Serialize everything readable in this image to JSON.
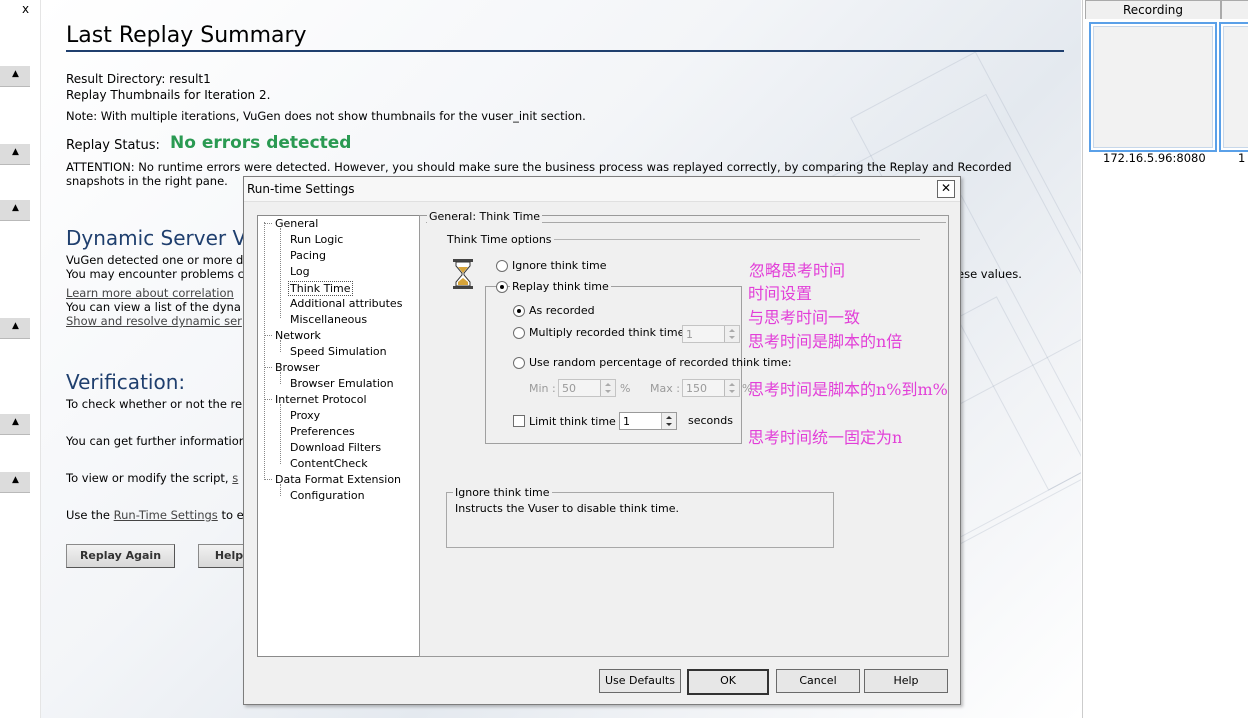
{
  "left_strip": {
    "close_symbol": "x",
    "scroll_symbol": "▲"
  },
  "summary": {
    "title": "Last Replay Summary",
    "result_directory": "Result Directory: result1",
    "thumbnails_line": "Replay Thumbnails for Iteration 2.",
    "note": "Note: With multiple iterations, VuGen does not show thumbnails for the vuser_init section.",
    "replay_status_label": "Replay Status:",
    "replay_status_value": "No errors detected",
    "attention_1": "ATTENTION: No runtime errors were detected. However, you should make sure the business process was replayed correctly, by comparing the Replay and Recorded",
    "attention_2": "snapshots in the right pane.",
    "dynamic_heading": "Dynamic Server Va",
    "dynamic_1": "VuGen detected one or more d",
    "dynamic_2": "You may encounter problems c",
    "dynamic_2_tail": "ese values.",
    "learn_link": "Learn more about correlation",
    "dynamic_3": "You can view a list of the dyna",
    "resolve_link": "Show and resolve dynamic ser",
    "verification_heading": "Verification:",
    "verification_1": "To check whether or not the re",
    "verification_2": "You can get further information",
    "verification_3_pre": "To view or modify the script, ",
    "verification_3_link": "s",
    "verification_4_pre": "Use the ",
    "verification_4_link": "Run-Time Settings",
    "verification_4_post": " to e",
    "replay_again_button": "Replay Again",
    "help_button": "Help"
  },
  "right_panel": {
    "tab_recording": "Recording",
    "thumb_label_1": "172.16.5.96:8080",
    "thumb_label_2": "1"
  },
  "dialog": {
    "title": "Run-time Settings",
    "close_symbol": "✕",
    "tree": [
      {
        "label": "General"
      },
      {
        "label": "Run Logic"
      },
      {
        "label": "Pacing"
      },
      {
        "label": "Log"
      },
      {
        "label": "Think Time"
      },
      {
        "label": "Additional attributes"
      },
      {
        "label": "Miscellaneous"
      },
      {
        "label": "Network"
      },
      {
        "label": "Speed Simulation"
      },
      {
        "label": "Browser"
      },
      {
        "label": "Browser Emulation"
      },
      {
        "label": "Internet Protocol"
      },
      {
        "label": "Proxy"
      },
      {
        "label": "Preferences"
      },
      {
        "label": "Download Filters"
      },
      {
        "label": "ContentCheck"
      },
      {
        "label": "Data Format Extension"
      },
      {
        "label": "Configuration"
      }
    ],
    "panel_title": "General: Think Time",
    "options_label": "Think Time options",
    "ignore_label": "Ignore think time",
    "replay_label": "Replay think time",
    "as_recorded_label": "As recorded",
    "multiply_label": "Multiply recorded think time by:",
    "multiply_value": "1",
    "random_label": "Use random percentage of recorded think time:",
    "min_label": "Min :",
    "min_value": "50",
    "percent_1": "%",
    "max_label": "Max :",
    "max_value": "150",
    "percent_2": "%",
    "limit_label": "Limit think time to:",
    "limit_value": "1",
    "seconds_label": "seconds",
    "desc_title": "Ignore think time",
    "desc_text": "Instructs the Vuser to disable think time.",
    "btn_defaults": "Use Defaults",
    "btn_ok": "OK",
    "btn_cancel": "Cancel",
    "btn_help": "Help"
  },
  "annotations": {
    "a1": "忽略思考时间",
    "a2": "时间设置",
    "a3": "与思考时间一致",
    "a4": "思考时间是脚本的n倍",
    "a5": "思考时间是脚本的n%到m%",
    "a6": "思考时间统一固定为n"
  },
  "colors": {
    "status_ok": "#2a9a52",
    "annotation": "#e23fd8",
    "heading_blue": "#1f3f6e"
  }
}
